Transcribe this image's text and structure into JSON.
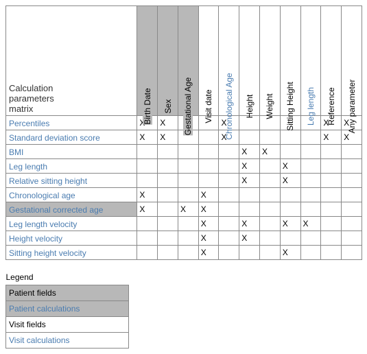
{
  "title_line1": "Calculation",
  "title_line2": "parameters",
  "title_line3": "matrix",
  "mark": "X",
  "columns": [
    {
      "key": "birth_date",
      "label": "Birth Date",
      "cls": "patient-field"
    },
    {
      "key": "sex",
      "label": "Sex",
      "cls": "patient-field"
    },
    {
      "key": "gest_age",
      "label": "Gestational Age",
      "cls": "patient-field"
    },
    {
      "key": "visit_date",
      "label": "Visit date",
      "cls": "visit-field"
    },
    {
      "key": "chron_age",
      "label": "Chronological Age",
      "cls": "patient-calc"
    },
    {
      "key": "height",
      "label": "Height",
      "cls": "visit-field"
    },
    {
      "key": "weight",
      "label": "Weight",
      "cls": "visit-field"
    },
    {
      "key": "sit_height",
      "label": "Sitting Height",
      "cls": "visit-field"
    },
    {
      "key": "leg_length_c",
      "label": "Leg length",
      "cls": "visit-calc"
    },
    {
      "key": "reference",
      "label": "Reference",
      "cls": "visit-field"
    },
    {
      "key": "any",
      "label": "Any parameter",
      "cls": "visit-field"
    }
  ],
  "rows": [
    {
      "label": "Percentiles",
      "cls": "visit-calc",
      "marks": [
        "birth_date",
        "sex",
        "chron_age",
        "reference",
        "any"
      ]
    },
    {
      "label": "Standard deviation score",
      "cls": "visit-calc",
      "marks": [
        "birth_date",
        "sex",
        "chron_age",
        "reference",
        "any"
      ]
    },
    {
      "label": "BMI",
      "cls": "visit-calc",
      "marks": [
        "height",
        "weight"
      ]
    },
    {
      "label": "Leg length",
      "cls": "visit-calc",
      "marks": [
        "height",
        "sit_height"
      ]
    },
    {
      "label": "Relative sitting height",
      "cls": "visit-calc",
      "marks": [
        "height",
        "sit_height"
      ]
    },
    {
      "label": "Chronological  age",
      "cls": "patient-calc",
      "marks": [
        "birth_date",
        "visit_date"
      ]
    },
    {
      "label": "Gestational corrected age",
      "cls": "patient-calc",
      "row_cls": "patient-field",
      "marks": [
        "birth_date",
        "gest_age",
        "visit_date"
      ]
    },
    {
      "label": "Leg length velocity",
      "cls": "visit-calc",
      "marks": [
        "visit_date",
        "height",
        "sit_height",
        "leg_length_c"
      ]
    },
    {
      "label": "Height velocity",
      "cls": "visit-calc",
      "marks": [
        "visit_date",
        "height"
      ]
    },
    {
      "label": "Sitting height velocity",
      "cls": "visit-calc",
      "marks": [
        "visit_date",
        "sit_height"
      ]
    }
  ],
  "legend": {
    "title": "Legend",
    "items": [
      {
        "label": "Patient fields",
        "cls": "patient-field"
      },
      {
        "label": "Patient calculations",
        "cls": "patient-calc",
        "bg": "patient-field"
      },
      {
        "label": "Visit fields",
        "cls": "visit-field"
      },
      {
        "label": "Visit calculations",
        "cls": "visit-calc"
      }
    ]
  }
}
